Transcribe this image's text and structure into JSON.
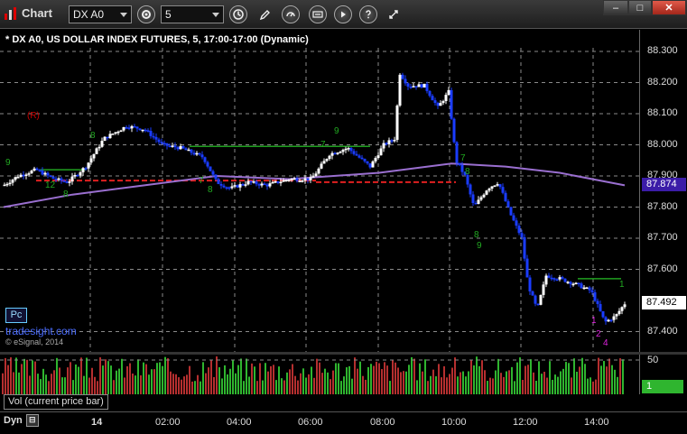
{
  "window": {
    "title": "Chart",
    "minimize": "–",
    "maximize": "□",
    "close": "✕"
  },
  "toolbar": {
    "symbol_value": "DX A0",
    "interval_value": "5"
  },
  "chart": {
    "title": "* DX A0, US DOLLAR INDEX FUTURES, 5, 17:00-17:00 (Dynamic)",
    "marker": "(R)",
    "pc_button": "Pc",
    "watermark": "tradesight.com",
    "copyright": "© eSignal, 2014",
    "price_ticks": [
      "88.300",
      "88.200",
      "88.100",
      "88.000",
      "87.900",
      "87.800",
      "87.700",
      "87.600",
      "87.400"
    ],
    "last_price": "87.492",
    "ma_value": "87.874",
    "volume_pane_label": "Vol (current price bar)",
    "volume_ticks": [
      "50"
    ],
    "volume_last": "1",
    "time_labels": [
      "14",
      "02:00",
      "04:00",
      "06:00",
      "08:00",
      "10:00",
      "12:00",
      "14:00"
    ],
    "dyn_label": "Dyn",
    "colors": {
      "up_candle": "#ffffff",
      "down_candle": "#1a3cff",
      "moving_average": "#9a6fd0",
      "support_line": "#e02020",
      "resistance_line": "#20a020",
      "grid": "#8a8a8a",
      "ma_tag": "#3b1ca8"
    }
  }
}
